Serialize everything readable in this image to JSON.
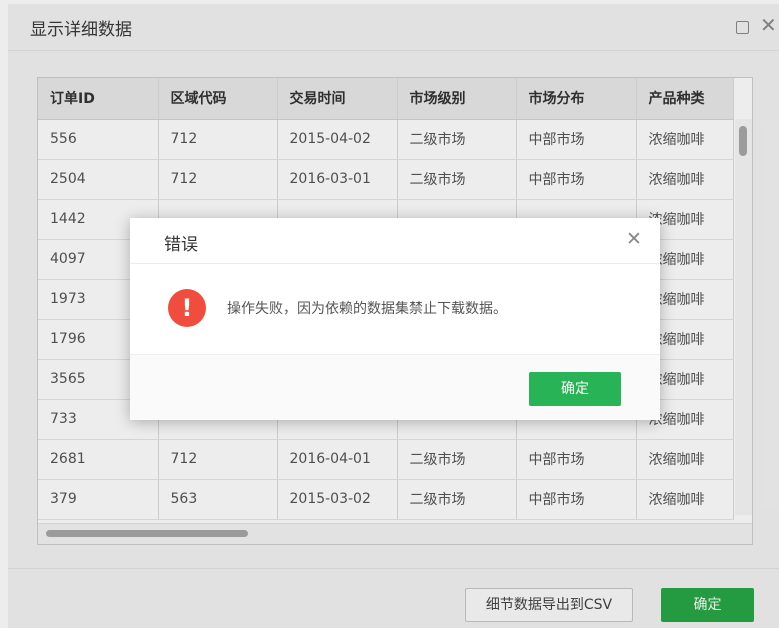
{
  "dialog": {
    "title": "显示详细数据",
    "maximize_icon": "maximize-icon",
    "close_glyph": "✕"
  },
  "table": {
    "columns": [
      "订单ID",
      "区域代码",
      "交易时间",
      "市场级别",
      "市场分布",
      "产品种类"
    ],
    "rows": [
      [
        "556",
        "712",
        "2015-04-02",
        "二级市场",
        "中部市场",
        "浓缩咖啡"
      ],
      [
        "2504",
        "712",
        "2016-03-01",
        "二级市场",
        "中部市场",
        "浓缩咖啡"
      ],
      [
        "1442",
        "",
        "",
        "",
        "",
        "浓缩咖啡"
      ],
      [
        "4097",
        "",
        "",
        "",
        "",
        "浓缩咖啡"
      ],
      [
        "1973",
        "",
        "",
        "",
        "",
        "浓缩咖啡"
      ],
      [
        "1796",
        "",
        "",
        "",
        "",
        "浓缩咖啡"
      ],
      [
        "3565",
        "",
        "",
        "",
        "",
        "浓缩咖啡"
      ],
      [
        "733",
        "",
        "",
        "",
        "",
        "浓缩咖啡"
      ],
      [
        "2681",
        "712",
        "2016-04-01",
        "二级市场",
        "中部市场",
        "浓缩咖啡"
      ],
      [
        "379",
        "563",
        "2015-03-02",
        "二级市场",
        "中部市场",
        "浓缩咖啡"
      ]
    ]
  },
  "footer": {
    "export_label": "细节数据导出到CSV",
    "ok_label": "确定"
  },
  "error_modal": {
    "title": "错误",
    "close_glyph": "✕",
    "icon_glyph": "!",
    "message": "操作失败，因为依赖的数据集禁止下载数据。",
    "ok_label": "确定"
  },
  "colors": {
    "primary_green": "#27b356",
    "error_red": "#f04d3f"
  }
}
